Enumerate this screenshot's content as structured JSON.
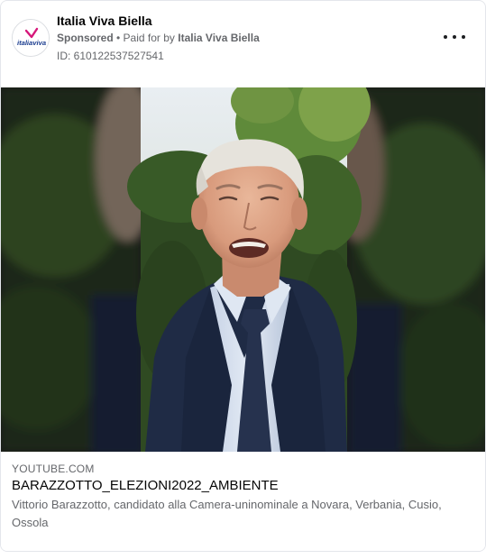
{
  "ad": {
    "page_name": "Italia Viva Biella",
    "sponsored_label": "Sponsored",
    "separator": " • ",
    "paid_for_prefix": "Paid for by ",
    "paid_for_name": "Italia Viva Biella",
    "id_text": "ID: 610122537527541",
    "avatar_logo_text": "italiaviva",
    "more_icon": "more-horizontal-icon"
  },
  "link": {
    "domain": "YOUTUBE.COM",
    "title": "BARAZZOTTO_ELEZIONI2022_AMBIENTE",
    "description": "Vittorio Barazzotto, candidato alla Camera-uninominale a Novara, Verbania, Cusio, Ossola"
  },
  "colors": {
    "logo_blue": "#1a3c8f",
    "logo_magenta": "#d6177a",
    "suit": "#1f2b45",
    "tie": "#26324e",
    "hedge": "#2f4a22"
  }
}
